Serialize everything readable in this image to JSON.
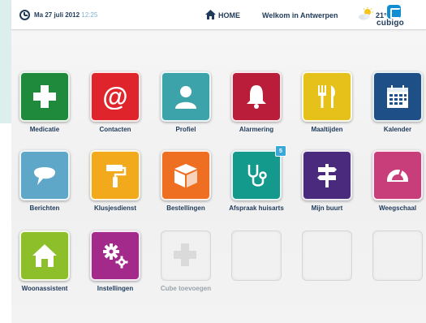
{
  "header": {
    "date": "Ma 27 juli 2012",
    "time": "12:25",
    "home_label": "HOME",
    "welcome": "Welkom in Antwerpen",
    "temperature": "21°",
    "logo_text": "cubigo"
  },
  "tiles": [
    {
      "label": "Medicatie",
      "color": "#1f8a3c",
      "icon": "plus-icon"
    },
    {
      "label": "Contacten",
      "color": "#e0242b",
      "icon": "at-sign-icon"
    },
    {
      "label": "Profiel",
      "color": "#3ba3a9",
      "icon": "person-icon"
    },
    {
      "label": "Alarmering",
      "color": "#b91d3a",
      "icon": "bell-icon"
    },
    {
      "label": "Maaltijden",
      "color": "#e6c11a",
      "icon": "fork-knife-icon"
    },
    {
      "label": "Kalender",
      "color": "#1f4f87",
      "icon": "calendar-icon"
    },
    {
      "label": "Berichten",
      "color": "#5fa7c8",
      "icon": "speech-bubble-icon"
    },
    {
      "label": "Klusjesdienst",
      "color": "#f2a91b",
      "icon": "paint-roller-icon"
    },
    {
      "label": "Bestellingen",
      "color": "#ee6f22",
      "icon": "package-icon"
    },
    {
      "label": "Afspraak huisarts",
      "color": "#139a8d",
      "icon": "stethoscope-icon",
      "badge": "5"
    },
    {
      "label": "Mijn buurt",
      "color": "#4a2a7c",
      "icon": "signpost-icon"
    },
    {
      "label": "Weegschaal",
      "color": "#c83e7a",
      "icon": "gauge-icon"
    },
    {
      "label": "Woonassistent",
      "color": "#8dbf2a",
      "icon": "house-icon"
    },
    {
      "label": "Instellingen",
      "color": "#a3298a",
      "icon": "gears-icon"
    },
    {
      "label": "Cube toevoegen",
      "color": "#eeeeee",
      "icon": "plus-icon"
    }
  ]
}
